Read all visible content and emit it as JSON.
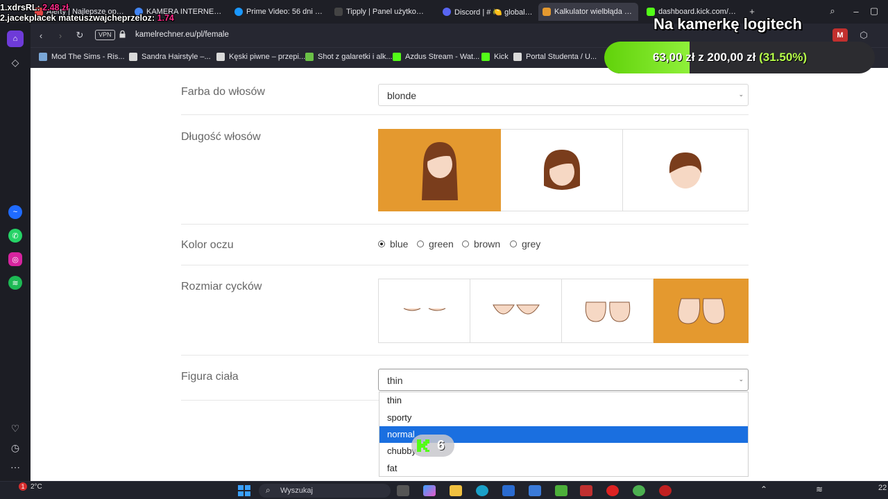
{
  "tabs": [
    {
      "label": "Alerty | Najlepsze oprogra",
      "color": "#e04545"
    },
    {
      "label": "KAMERA INTERNETOWA F",
      "color": "#4285f4"
    },
    {
      "label": "Prime Video: 56 dni - Sezo",
      "color": "#1a98ff"
    },
    {
      "label": "Tipply | Panel użytkownika",
      "color": "#222"
    },
    {
      "label": "Discord | # 🍋 global | Me",
      "color": "#5865f2"
    },
    {
      "label": "Kalkulator wielbłąda - ory",
      "color": "#e4992f"
    },
    {
      "label": "dashboard.kick.com/strea",
      "color": "#53fc18"
    }
  ],
  "address": {
    "vpn": "VPN",
    "url": "kamelrechner.eu/pl/female"
  },
  "bookmarks": [
    {
      "label": "Mod The Sims - Ris...",
      "color": "#7aa7d8"
    },
    {
      "label": "Sandra Hairstyle –...",
      "color": "#d9d9d9"
    },
    {
      "label": "Kęski piwne – przepi...",
      "color": "#d9d9d9"
    },
    {
      "label": "Shot z galaretki i alk...",
      "color": "#6ac046"
    },
    {
      "label": "Azdus Stream - Wat...",
      "color": "#53fc18"
    },
    {
      "label": "Kick",
      "color": "#53fc18"
    },
    {
      "label": "Portal Studenta / U...",
      "color": "#d9d9d9"
    }
  ],
  "form": {
    "hair_color_label": "Farba do włosów",
    "hair_color_value": "blonde",
    "hair_length_label": "Długość włosów",
    "eye_color_label": "Kolor oczu",
    "eye_options": [
      "blue",
      "green",
      "brown",
      "grey"
    ],
    "eye_selected": "blue",
    "bust_label": "Rozmiar cycków",
    "figure_label": "Figura ciała",
    "figure_value": "thin",
    "figure_options": [
      "thin",
      "sporty",
      "normal",
      "chubby",
      "fat"
    ],
    "figure_highlighted": "normal"
  },
  "overlay": {
    "line1_prefix": "1.xdrsRL:",
    "line1_value": "2.48 zł",
    "line2_prefix": "2.jacekplacek mateuszwajcheprzeloz:",
    "line2_value": "1.74",
    "camera_text": "Na kamerkę logitech",
    "goal_text": "63,00 zł z 200,00 zł",
    "goal_percent": "(31.50%)",
    "goal_fraction": 0.315,
    "kick_count": "6"
  },
  "taskbar": {
    "weather": "2°C",
    "search_placeholder": "Wyszukaj",
    "clock": "22"
  },
  "colors": {
    "accent": "#e4992f",
    "highlight": "#1a6fe0",
    "kick_green": "#53fc18"
  }
}
